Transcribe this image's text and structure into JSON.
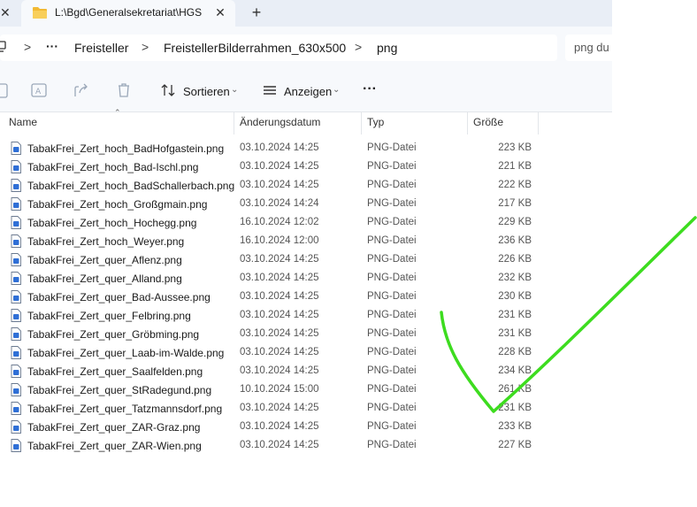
{
  "tabs": {
    "active_title": "L:\\Bgd\\Generalsekretariat\\HGS",
    "new_tab_label": "+",
    "close_label": "✕"
  },
  "address": {
    "ellipsis": "···",
    "crumbs": [
      "Freisteller",
      "FreistellerBilderrahmen_630x500",
      "png"
    ],
    "search_placeholder": "png du"
  },
  "toolbar": {
    "sort_label": "Sortieren",
    "view_label": "Anzeigen",
    "more_label": "···"
  },
  "columns": {
    "name": "Name",
    "date": "Änderungsdatum",
    "type": "Typ",
    "size": "Größe"
  },
  "files": [
    {
      "name": "TabakFrei_Zert_hoch_BadHofgastein.png",
      "date": "03.10.2024 14:25",
      "type": "PNG-Datei",
      "size": "223 KB"
    },
    {
      "name": "TabakFrei_Zert_hoch_Bad-Ischl.png",
      "date": "03.10.2024 14:25",
      "type": "PNG-Datei",
      "size": "221 KB"
    },
    {
      "name": "TabakFrei_Zert_hoch_BadSchallerbach.png",
      "date": "03.10.2024 14:25",
      "type": "PNG-Datei",
      "size": "222 KB"
    },
    {
      "name": "TabakFrei_Zert_hoch_Großgmain.png",
      "date": "03.10.2024 14:24",
      "type": "PNG-Datei",
      "size": "217 KB"
    },
    {
      "name": "TabakFrei_Zert_hoch_Hochegg.png",
      "date": "16.10.2024 12:02",
      "type": "PNG-Datei",
      "size": "229 KB"
    },
    {
      "name": "TabakFrei_Zert_hoch_Weyer.png",
      "date": "16.10.2024 12:00",
      "type": "PNG-Datei",
      "size": "236 KB"
    },
    {
      "name": "TabakFrei_Zert_quer_Aflenz.png",
      "date": "03.10.2024 14:25",
      "type": "PNG-Datei",
      "size": "226 KB"
    },
    {
      "name": "TabakFrei_Zert_quer_Alland.png",
      "date": "03.10.2024 14:25",
      "type": "PNG-Datei",
      "size": "232 KB"
    },
    {
      "name": "TabakFrei_Zert_quer_Bad-Aussee.png",
      "date": "03.10.2024 14:25",
      "type": "PNG-Datei",
      "size": "230 KB"
    },
    {
      "name": "TabakFrei_Zert_quer_Felbring.png",
      "date": "03.10.2024 14:25",
      "type": "PNG-Datei",
      "size": "231 KB"
    },
    {
      "name": "TabakFrei_Zert_quer_Gröbming.png",
      "date": "03.10.2024 14:25",
      "type": "PNG-Datei",
      "size": "231 KB"
    },
    {
      "name": "TabakFrei_Zert_quer_Laab-im-Walde.png",
      "date": "03.10.2024 14:25",
      "type": "PNG-Datei",
      "size": "228 KB"
    },
    {
      "name": "TabakFrei_Zert_quer_Saalfelden.png",
      "date": "03.10.2024 14:25",
      "type": "PNG-Datei",
      "size": "234 KB"
    },
    {
      "name": "TabakFrei_Zert_quer_StRadegund.png",
      "date": "10.10.2024 15:00",
      "type": "PNG-Datei",
      "size": "261 KB"
    },
    {
      "name": "TabakFrei_Zert_quer_Tatzmannsdorf.png",
      "date": "03.10.2024 14:25",
      "type": "PNG-Datei",
      "size": "231 KB"
    },
    {
      "name": "TabakFrei_Zert_quer_ZAR-Graz.png",
      "date": "03.10.2024 14:25",
      "type": "PNG-Datei",
      "size": "233 KB"
    },
    {
      "name": "TabakFrei_Zert_quer_ZAR-Wien.png",
      "date": "03.10.2024 14:25",
      "type": "PNG-Datei",
      "size": "227 KB"
    }
  ],
  "colors": {
    "folder": "#f2b933",
    "file_icon": "#2f6fd6",
    "checkmark": "#3ddc1f"
  }
}
